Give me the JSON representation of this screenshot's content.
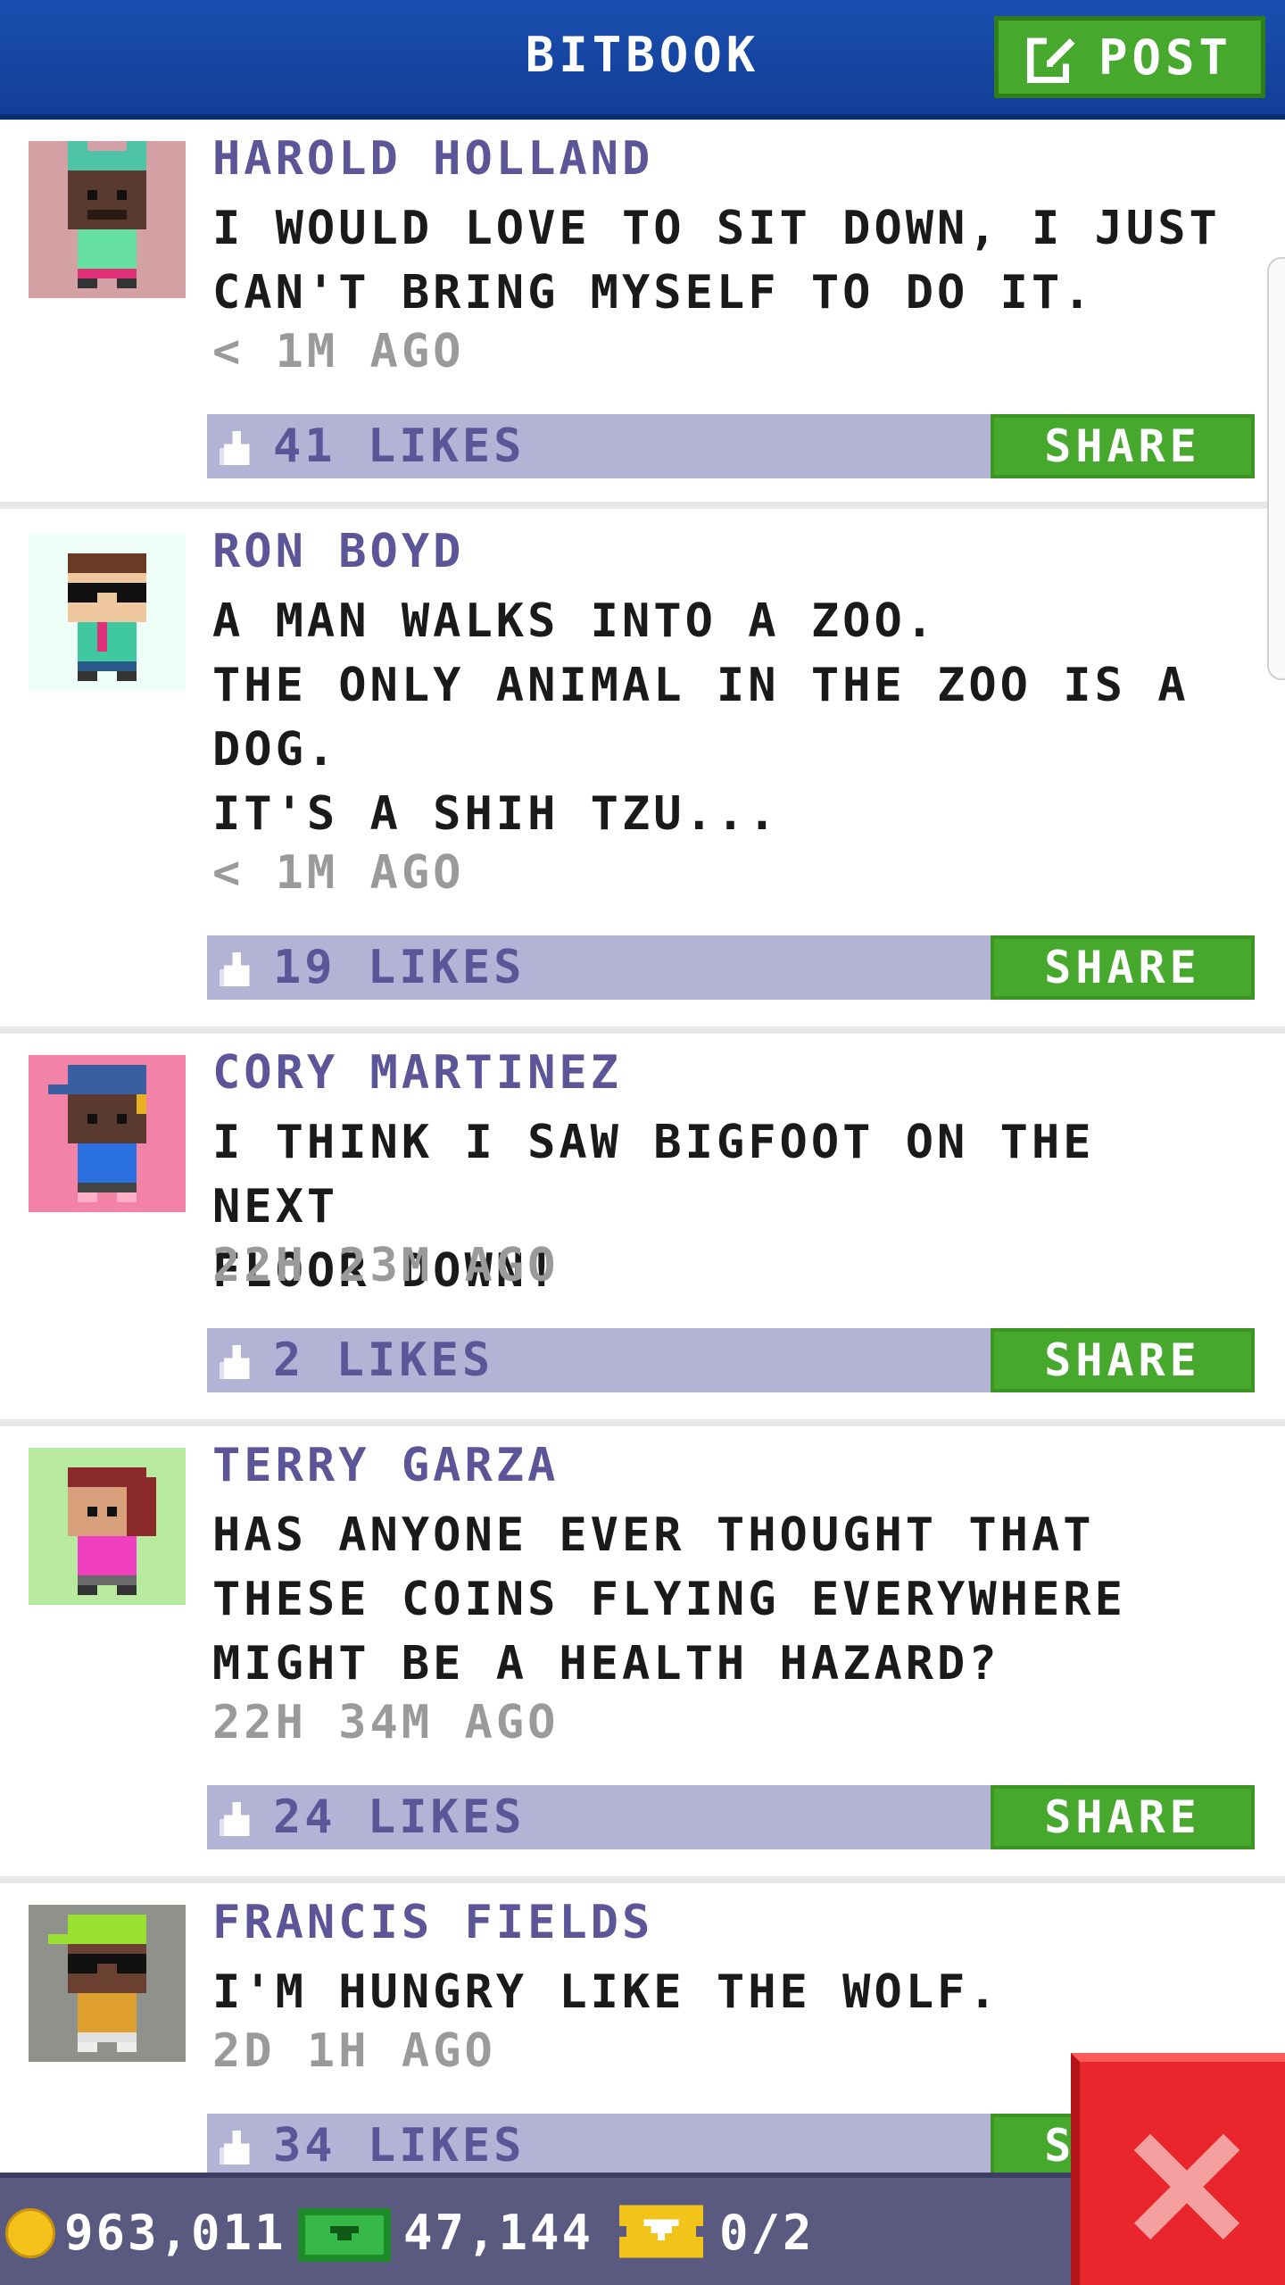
{
  "header": {
    "title": "BITBOOK",
    "post_label": "POST",
    "post_icon": "edit-icon"
  },
  "posts": [
    {
      "author": "HAROLD HOLLAND",
      "text": "I WOULD LOVE TO SIT DOWN, I JUST\nCAN'T BRING MYSELF TO DO IT.",
      "time": "< 1M AGO",
      "likes": "41 LIKES",
      "share_label": "SHARE",
      "avatar_bg": "#d3a1a4"
    },
    {
      "author": "RON BOYD",
      "text": "A MAN WALKS INTO A ZOO.\nTHE ONLY ANIMAL IN THE ZOO IS A\nDOG.\nIT'S A SHIH TZU...",
      "time": "< 1M AGO",
      "likes": "19 LIKES",
      "share_label": "SHARE",
      "avatar_bg": "#eefff8"
    },
    {
      "author": "CORY MARTINEZ",
      "text": "I THINK I SAW BIGFOOT ON THE NEXT\nFLOOR DOWN!",
      "time": "22H 23M AGO",
      "likes": "2 LIKES",
      "share_label": "SHARE",
      "avatar_bg": "#f283a6"
    },
    {
      "author": "TERRY GARZA",
      "text": "HAS ANYONE EVER THOUGHT THAT\nTHESE COINS FLYING EVERYWHERE\nMIGHT BE A HEALTH HAZARD?",
      "time": "22H 34M AGO",
      "likes": "24 LIKES",
      "share_label": "SHARE",
      "avatar_bg": "#b8eaa0"
    },
    {
      "author": "FRANCIS FIELDS",
      "text": "I'M HUNGRY LIKE THE WOLF.",
      "time": "2D 1H AGO",
      "likes": "34 LIKES",
      "share_label": "SHARE",
      "avatar_bg": "#8e928a"
    }
  ],
  "status": {
    "coins": "963,011",
    "bux": "47,144",
    "tickets": "0/2"
  },
  "colors": {
    "header": "#1a4fb0",
    "accent_green": "#46a82d",
    "likes_bar": "#b3b3d6",
    "author": "#5c5598",
    "close": "#e8262c"
  }
}
